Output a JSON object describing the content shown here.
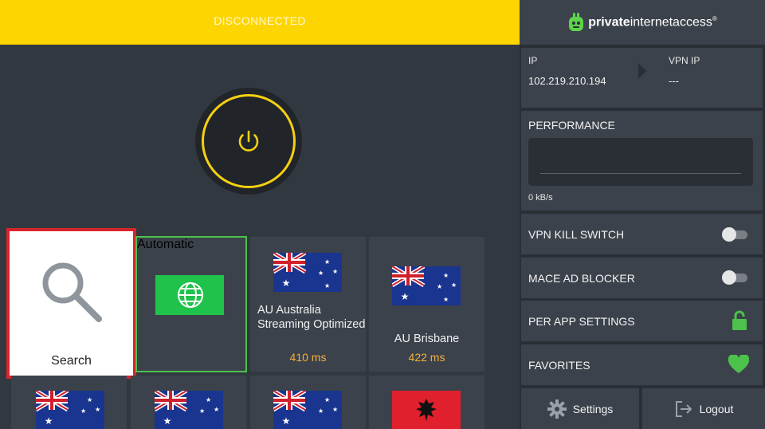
{
  "status": {
    "text": "DISCONNECTED",
    "color": "#fdd500"
  },
  "brand": {
    "bold": "private",
    "rest": "internetaccess",
    "mark": "®",
    "logo_icon": "robot-icon"
  },
  "connection": {
    "ip_label": "IP",
    "ip_value": "102.219.210.194",
    "vpn_ip_label": "VPN IP",
    "vpn_ip_value": "---"
  },
  "performance": {
    "title": "PERFORMANCE",
    "rate": "0 kB/s"
  },
  "settings_rows": {
    "kill_switch": "VPN KILL SWITCH",
    "mace": "MACE AD BLOCKER",
    "per_app": "PER APP SETTINGS",
    "favorites": "FAVORITES"
  },
  "bottom_buttons": {
    "settings": "Settings",
    "logout": "Logout"
  },
  "tiles": {
    "search": "Search",
    "automatic": "Automatic",
    "au_streaming": {
      "label": "AU Australia Streaming Optimized",
      "ms": "410 ms"
    },
    "au_brisbane": {
      "label": "AU Brisbane",
      "ms": "422 ms"
    }
  },
  "colors": {
    "accent_yellow": "#f5d010",
    "green": "#4cc24c",
    "latency": "#f5b13c",
    "search_border": "#d8252c"
  }
}
